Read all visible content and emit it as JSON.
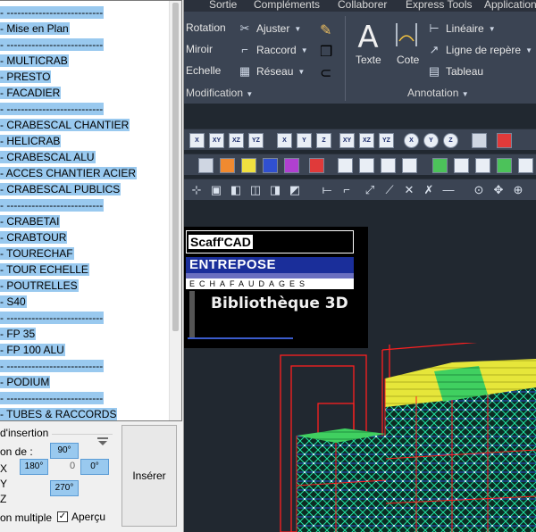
{
  "palette": {
    "items": [
      "- ---------------------------",
      "- Mise en Plan",
      "- ---------------------------",
      "- MULTICRAB",
      "- PRESTO",
      "- FACADIER",
      "- ---------------------------",
      "- CRABESCAL CHANTIER",
      "- HELICRAB",
      "- CRABESCAL ALU",
      "- ACCES CHANTIER ACIER",
      "- CRABESCAL PUBLICS",
      "- ---------------------------",
      "- CRABETAI",
      "- CRABTOUR",
      "- TOURECHAF",
      "- TOUR ECHELLE",
      "- POUTRELLES",
      "- S40",
      "- ---------------------------",
      "- FP 35",
      "- FP 100 ALU",
      "- ---------------------------",
      "- PODIUM",
      "- ---------------------------",
      "- TUBES & RACCORDS"
    ],
    "group_title": "d'insertion",
    "rotation_label": "on de :",
    "axis_x": "X",
    "axis_y": "Y",
    "axis_z": "Z",
    "rot_90": "90°",
    "rot_180": "180°",
    "rot_0": "0°",
    "rot_270": "270°",
    "center_value": "0",
    "multi_label": "on multiple",
    "apercu_label": "Aperçu",
    "apercu_checked": "✓",
    "insert_button": "Insérer"
  },
  "ribbon": {
    "tabs": [
      "Sortie",
      "Compléments",
      "Collaborer",
      "Express Tools",
      "Application"
    ],
    "rotation": "Rotation",
    "ajuster": "Ajuster",
    "miroir": "Miroir",
    "raccord": "Raccord",
    "echelle": "Echelle",
    "reseau": "Réseau",
    "panel_modification": "Modification",
    "texte": "Texte",
    "texte_glyph": "A",
    "cote": "Cote",
    "lineaire": "Linéaire",
    "ligne_repere": "Ligne de repère",
    "tableau": "Tableau",
    "panel_annotation": "Annotation"
  },
  "toolbar_row1": [
    "X",
    "XY",
    "XZ",
    "YZ",
    "X",
    "Y",
    "Z",
    "XY",
    "XZ",
    "YZ",
    "X",
    "Y",
    "Z"
  ],
  "logo": {
    "scaff": "Scaff'CAD",
    "entrepose": "ENTREPOSE",
    "echafaudages": "ECHAFAUDAGES",
    "biblio": "Bibliothèque 3D"
  },
  "colors": {
    "selection": "#99c9ef",
    "ribbon_bg": "#3b4453",
    "drawing_bg": "#212830",
    "scaffold_red": "#ff2020",
    "scaffold_green": "#20e0a0",
    "scaffold_yellow": "#f0f020"
  }
}
